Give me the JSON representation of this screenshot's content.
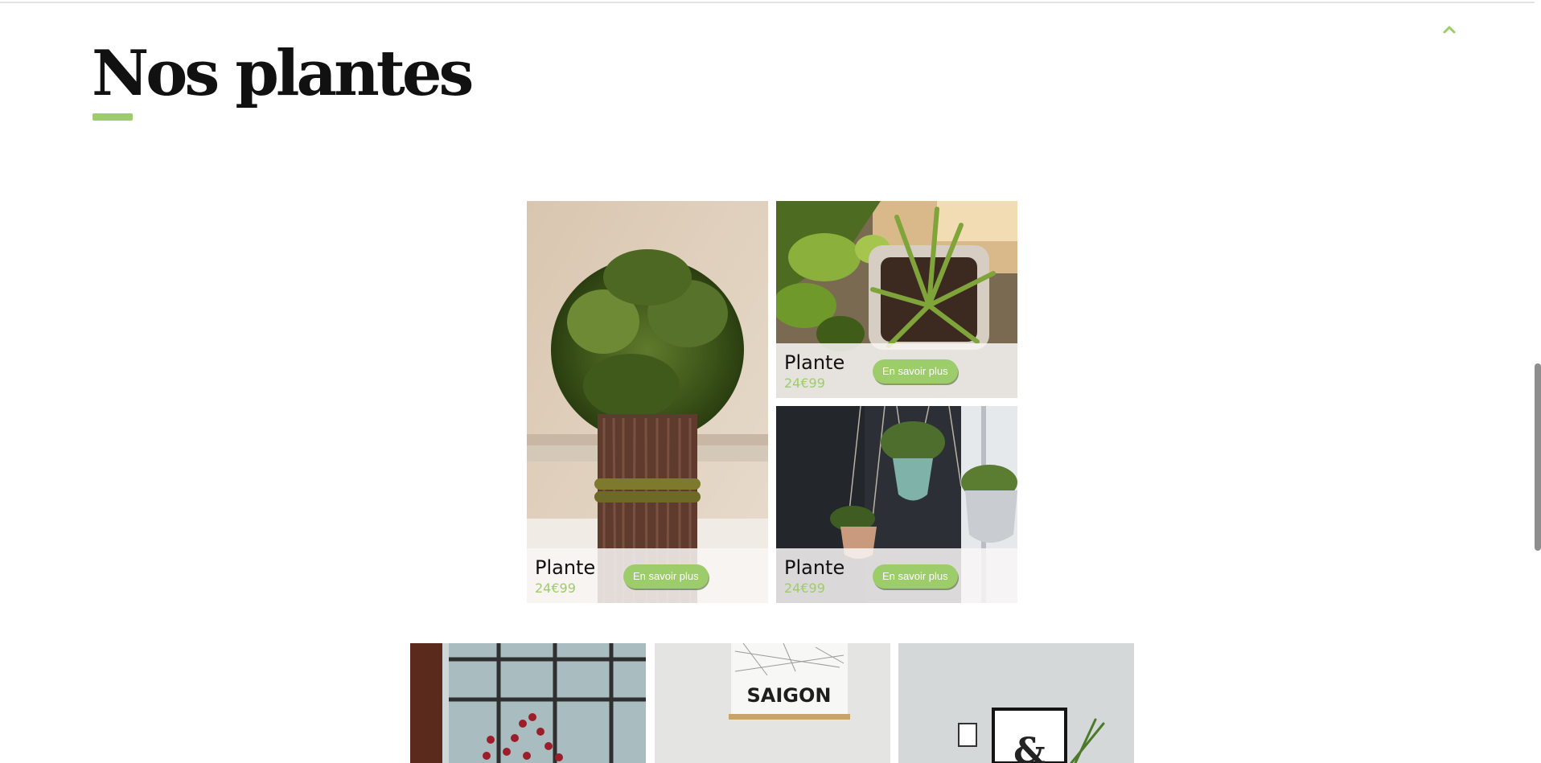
{
  "theme": {
    "accent": "#9dcd6b",
    "title_color": "#111111"
  },
  "header": {
    "title": "Nos plantes",
    "scroll_top_icon": "chevron-up-icon"
  },
  "products": [
    {
      "name": "Plante",
      "price": "24€99",
      "button_label": "En savoir plus",
      "image": "boxwood-bundle-photo"
    },
    {
      "name": "Plante",
      "price": "24€99",
      "button_label": "En savoir plus",
      "image": "potted-spider-plant-photo"
    },
    {
      "name": "Plante",
      "price": "24€99",
      "button_label": "En savoir plus",
      "image": "hanging-planters-photo"
    }
  ],
  "gallery": [
    {
      "image": "red-berry-branches-window-photo"
    },
    {
      "image": "saigon-map-poster-photo",
      "poster_text": "SAIGON"
    },
    {
      "image": "ampersand-frame-photo",
      "poster_text": "&"
    }
  ]
}
